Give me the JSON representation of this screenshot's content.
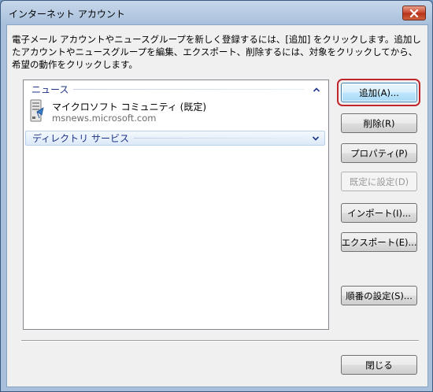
{
  "window": {
    "title": "インターネット アカウント"
  },
  "description": "電子メール アカウントやニュースグループを新しく登録するには、[追加] をクリックします。追加したアカウントやニュースグループを編集、エクスポート、削除するには、対象をクリックしてから、希望の動作をクリックします。",
  "groups": [
    {
      "label": "ニュース",
      "expanded": true,
      "items": [
        {
          "name": "マイクロソフト コミュニティ (既定)",
          "server": "msnews.microsoft.com",
          "icon": "news-server-icon"
        }
      ]
    },
    {
      "label": "ディレクトリ サービス",
      "expanded": false,
      "items": []
    }
  ],
  "buttons": {
    "add": "追加(A)...",
    "remove": "削除(R)",
    "properties": "プロパティ(P)",
    "set_default": "既定に設定(D)",
    "import": "インポート(I)...",
    "export": "エクスポート(E)...",
    "order": "順番の設定(S)...",
    "close": "閉じる"
  },
  "colors": {
    "group_label": "#1e3287",
    "focus_ring": "#c0272d",
    "close_button": "#c8452e"
  }
}
